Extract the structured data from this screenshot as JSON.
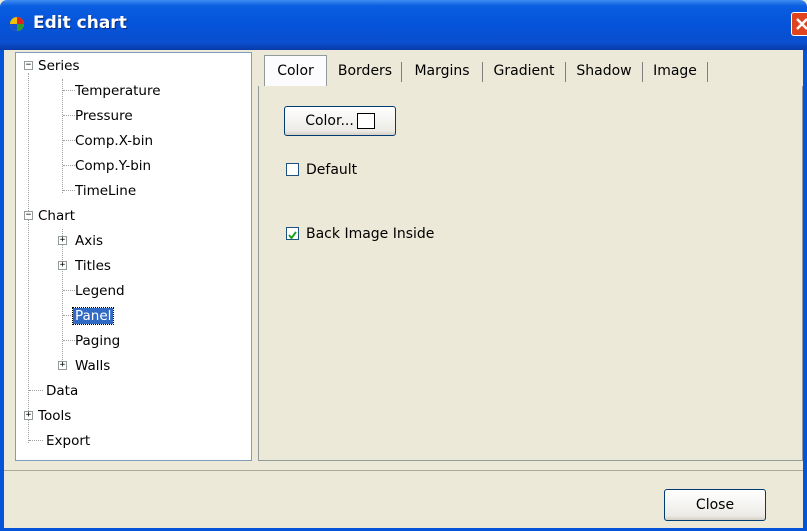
{
  "window": {
    "title": "Edit chart",
    "icon": "chart-app-icon",
    "close_icon": "close-x-icon"
  },
  "tree": {
    "items": [
      {
        "label": "Series",
        "expander": "−"
      },
      {
        "label": "Temperature"
      },
      {
        "label": "Pressure"
      },
      {
        "label": "Comp.X-bin"
      },
      {
        "label": "Comp.Y-bin"
      },
      {
        "label": "TimeLine"
      },
      {
        "label": "Chart",
        "expander": "−"
      },
      {
        "label": "Axis",
        "expander": "+"
      },
      {
        "label": "Titles",
        "expander": "+"
      },
      {
        "label": "Legend"
      },
      {
        "label": "Panel",
        "selected": true
      },
      {
        "label": "Paging"
      },
      {
        "label": "Walls",
        "expander": "+"
      },
      {
        "label": "Data"
      },
      {
        "label": "Tools",
        "expander": "+"
      },
      {
        "label": "Export"
      }
    ]
  },
  "tabs": [
    {
      "label": "Color",
      "active": true
    },
    {
      "label": "Borders"
    },
    {
      "label": "Margins"
    },
    {
      "label": "Gradient"
    },
    {
      "label": "Shadow"
    },
    {
      "label": "Image"
    }
  ],
  "panel": {
    "color_button_label": "Color...",
    "color_value": "#ffffff",
    "default_checkbox": {
      "label": "Default",
      "checked": false
    },
    "back_image_inside_checkbox": {
      "label": "Back Image Inside",
      "checked": true
    }
  },
  "footer": {
    "close_label": "Close"
  }
}
